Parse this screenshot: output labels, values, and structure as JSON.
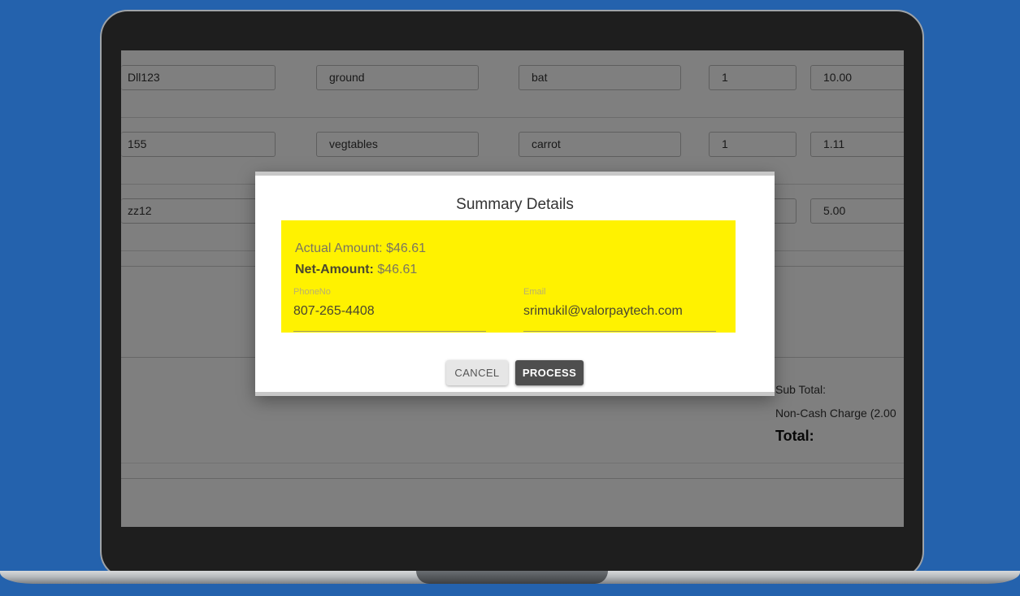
{
  "rows": [
    {
      "c1": "Dll123",
      "c2": "ground",
      "c3": "bat",
      "c4": "1",
      "c5": "10.00"
    },
    {
      "c1": "155",
      "c2": "vegtables",
      "c3": "carrot",
      "c4": "1",
      "c5": "1.11"
    },
    {
      "c1": "zz12",
      "c2": "",
      "c3": "",
      "c4": "",
      "c5": "5.00"
    }
  ],
  "totals": {
    "sub_total_label": "Sub Total:",
    "non_cash_label": "Non-Cash Charge (2.00",
    "total_label": "Total:"
  },
  "dialog": {
    "title": "Summary Details",
    "actual_amount_label": "Actual Amount:",
    "actual_amount_value": "$46.61",
    "net_amount_label": "Net-Amount:",
    "net_amount_value": "$46.61",
    "phone_label": "PhoneNo",
    "phone_value": "807-265-4408",
    "email_label": "Email",
    "email_value": "srimukil@valorpaytech.com",
    "cancel_label": "CANCEL",
    "process_label": "PROCESS"
  },
  "colors": {
    "page_background": "#2462ad",
    "highlight": "#fff200",
    "process_button": "#4e4e4e"
  }
}
